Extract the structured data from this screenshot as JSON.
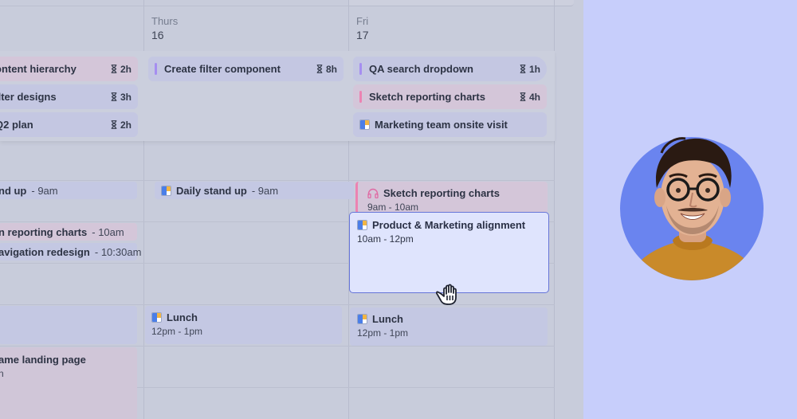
{
  "days": [
    {
      "name": "Thurs",
      "num": "16"
    },
    {
      "name": "Fri",
      "num": "17"
    }
  ],
  "allday": {
    "col1": [
      {
        "title": "ontent hierarchy",
        "dur": "2h"
      },
      {
        "title": "ilter designs",
        "dur": "3h"
      },
      {
        "title": "Q2 plan",
        "dur": "2h"
      }
    ],
    "col2": [
      {
        "title": "Create filter component",
        "dur": "8h"
      }
    ],
    "col3": [
      {
        "title": "QA search dropdown",
        "dur": "1h"
      },
      {
        "title": "Sketch reporting charts",
        "dur": "4h"
      },
      {
        "title": "Marketing team onsite visit"
      }
    ]
  },
  "events": {
    "standup_left": {
      "title": "nd up",
      "time": "- 9am"
    },
    "reporting_left": {
      "title": "n reporting charts",
      "time": "- 10am"
    },
    "navigation_left": {
      "title": "avigation redesign",
      "time": "- 10:30am"
    },
    "standup_thu": {
      "title": "Daily stand up",
      "time": "- 9am"
    },
    "sketch_fri": {
      "title": "Sketch reporting charts",
      "time": "9am - 10am"
    },
    "lunch_thu": {
      "title": "Lunch",
      "time": "12pm - 1pm"
    },
    "lunch_fri": {
      "title": "Lunch",
      "time": "12pm - 1pm"
    },
    "landing_left": {
      "title": "ame landing page",
      "time": "n"
    }
  },
  "dragged_event": {
    "title": "Product & Marketing alignment",
    "time": "10am - 12pm"
  },
  "colors": {
    "accent": "#6675d8",
    "purple_bar": "#a58ef0",
    "pink_bar": "#ec83b2",
    "avatar_bg": "#6a84ef",
    "sweater": "#c98a2a"
  },
  "icons": [
    "hourglass-icon",
    "google-calendar-icon",
    "headphones-icon",
    "grab-hand-cursor-icon"
  ]
}
